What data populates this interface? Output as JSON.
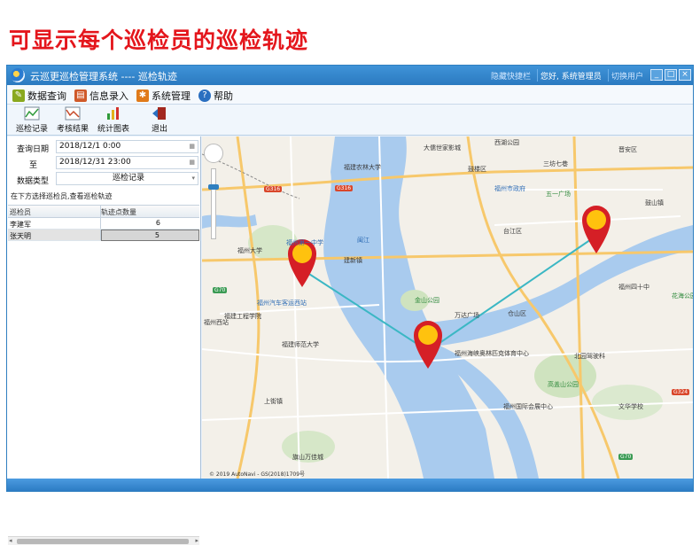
{
  "banner": {
    "title": "可显示每个巡检员的巡检轨迹"
  },
  "window": {
    "title": "云巡更巡检管理系统 ---- 巡检轨迹",
    "quick_bar": "隐藏快捷栏",
    "greeting": "您好, 系统管理员",
    "switch_user": "切换用户",
    "buttons": {
      "minimize": "_",
      "maximize": "□",
      "close": "×"
    }
  },
  "menu": {
    "items": [
      {
        "label": "数据查询",
        "icon": "data-query-icon",
        "color": "#8aa91f"
      },
      {
        "label": "信息录入",
        "icon": "info-entry-icon",
        "color": "#d05a2a"
      },
      {
        "label": "系统管理",
        "icon": "gear-icon",
        "color": "#e07a1a"
      },
      {
        "label": "帮助",
        "icon": "help-icon",
        "color": "#2a6fc0"
      }
    ]
  },
  "toolbar": {
    "items": [
      {
        "label": "巡检记录",
        "icon": "inspection-record-icon"
      },
      {
        "label": "考核结果",
        "icon": "assessment-icon"
      },
      {
        "label": "统计图表",
        "icon": "bar-chart-icon"
      },
      {
        "label": "退出",
        "icon": "exit-icon"
      }
    ]
  },
  "query": {
    "date_label": "查询日期",
    "date_from": "2018/12/1 0:00",
    "to_label": "至",
    "date_to": "2018/12/31 23:00",
    "type_label": "数据类型",
    "type_value": "巡检记录",
    "hint": "在下方选择巡检员,查看巡检轨迹"
  },
  "grid": {
    "headers": [
      "巡检员",
      "轨迹点数量"
    ],
    "rows": [
      {
        "name": "李建军",
        "count": "6"
      },
      {
        "name": "张天明",
        "count": "5"
      }
    ]
  },
  "map": {
    "copyright": "© 2019 AutoNavi - GS(2018)1709号",
    "labels": [
      "西湖公园",
      "福州市政府",
      "鼓楼区",
      "晋安区",
      "三坊七巷",
      "五一广场",
      "福建农林大学",
      "大儒世家影城",
      "福州大学",
      "福州第一中学",
      "建新镇",
      "金山公园",
      "万达广场",
      "闽江",
      "台江区",
      "仓山区",
      "福州西站",
      "福州汽车客运西站",
      "上街镇",
      "高盖山公园",
      "福州国际会展中心",
      "福州海峡奥林匹克体育中心",
      "花海公园",
      "福州四十中",
      "北园驾驶科",
      "福建工程学院",
      "福建师范大学",
      "旗山万佳城",
      "文华学校",
      "鼓山镇"
    ],
    "roads": [
      "G316",
      "G316",
      "G70",
      "G70",
      "G324"
    ],
    "pins": [
      "pin-1",
      "pin-2",
      "pin-3"
    ]
  },
  "colors": {
    "brand_red": "#e4161c",
    "title_bar": "#2b7ac0",
    "route": "#3bb7c4",
    "pin": "#d51f26",
    "pin_head": "#ffc20e",
    "river": "#a7c9ee"
  }
}
